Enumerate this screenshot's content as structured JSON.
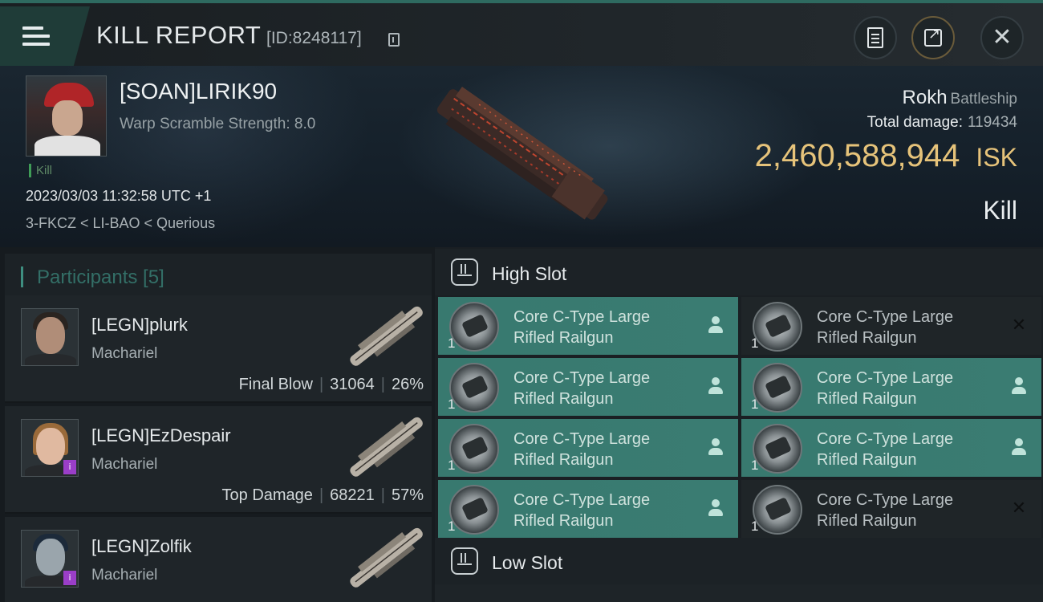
{
  "header": {
    "title": "KILL REPORT",
    "report_id": "[ID:8248117]",
    "icons": [
      "menu-icon",
      "copy-icon",
      "clipboard-icon",
      "share-icon",
      "close-icon"
    ]
  },
  "victim": {
    "name": "[SOAN]LIRIK90",
    "warp_scramble": "Warp Scramble Strength: 8.0",
    "kill_tag": "Kill",
    "datetime": "2023/03/03 11:32:58 UTC +1",
    "location": "3-FKCZ < LI-BAO < Querious",
    "ship": "Rokh",
    "ship_class": "Battleship",
    "total_damage_label": "Total damage:",
    "total_damage": "119434",
    "isk_value": "2,460,588,944",
    "isk_unit": "ISK",
    "result": "Kill"
  },
  "participants": {
    "title": "Participants [5]",
    "list": [
      {
        "name": "[LEGN]plurk",
        "ship": "Machariel",
        "role": "Final Blow",
        "damage": "31064",
        "percent": "26%"
      },
      {
        "name": "[LEGN]EzDespair",
        "ship": "Machariel",
        "role": "Top Damage",
        "damage": "68221",
        "percent": "57%"
      },
      {
        "name": "[LEGN]Zolfik",
        "ship": "Machariel",
        "role": "",
        "damage": "",
        "percent": ""
      }
    ]
  },
  "slots": {
    "high": {
      "title": "High Slot",
      "items": [
        {
          "line1": "Core C-Type Large",
          "line2": "Rifled Railgun",
          "qty": "1",
          "state": "dropped"
        },
        {
          "line1": "Core C-Type Large",
          "line2": "Rifled Railgun",
          "qty": "1",
          "state": "destroyed"
        },
        {
          "line1": "Core C-Type Large",
          "line2": "Rifled Railgun",
          "qty": "1",
          "state": "dropped"
        },
        {
          "line1": "Core C-Type Large",
          "line2": "Rifled Railgun",
          "qty": "1",
          "state": "dropped"
        },
        {
          "line1": "Core C-Type Large",
          "line2": "Rifled Railgun",
          "qty": "1",
          "state": "dropped"
        },
        {
          "line1": "Core C-Type Large",
          "line2": "Rifled Railgun",
          "qty": "1",
          "state": "dropped"
        },
        {
          "line1": "Core C-Type Large",
          "line2": "Rifled Railgun",
          "qty": "1",
          "state": "dropped"
        },
        {
          "line1": "Core C-Type Large",
          "line2": "Rifled Railgun",
          "qty": "1",
          "state": "destroyed"
        }
      ]
    },
    "low": {
      "title": "Low Slot"
    }
  },
  "colors": {
    "accent": "#3a7c72",
    "isk": "#e6c37a",
    "kill_tag": "#3f9c57",
    "badge": "#9a3ec8"
  }
}
